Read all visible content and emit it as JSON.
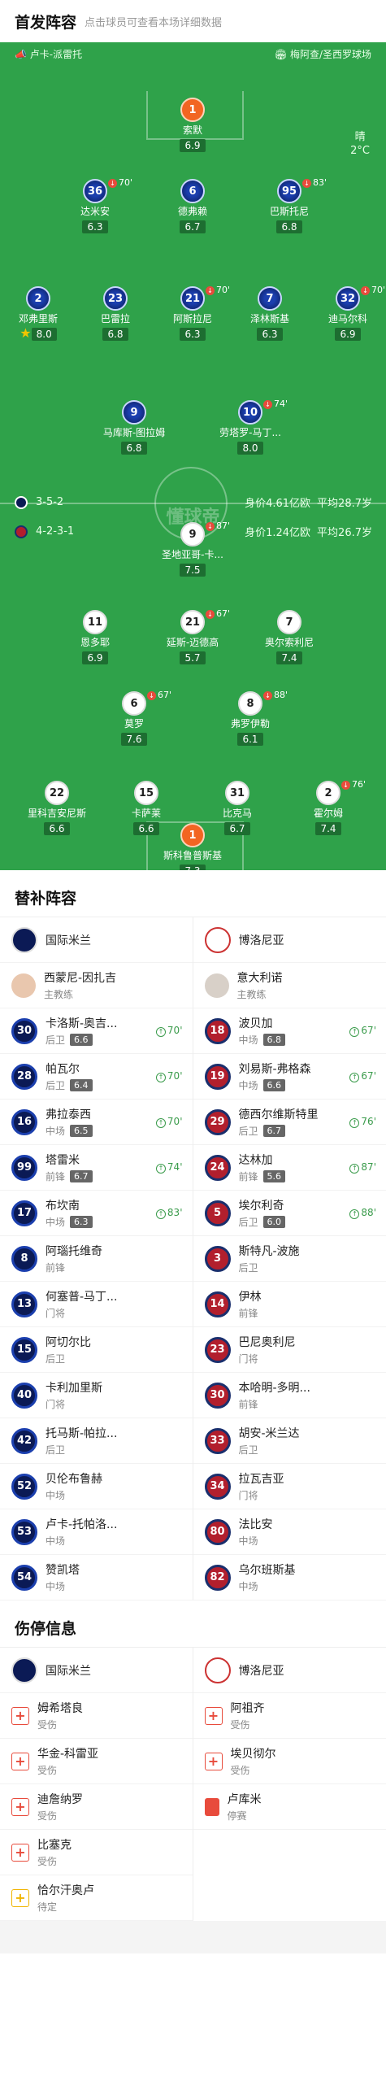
{
  "header": {
    "title": "首发阵容",
    "subtitle": "点击球员可查看本场详细数据"
  },
  "venue": {
    "referee": "卢卡-派雷托",
    "stadium": "梅阿查/圣西罗球场"
  },
  "weather": {
    "condition": "晴",
    "temp": "2°C"
  },
  "watermark": "懂球帝",
  "inter_info": {
    "formation": "3-5-2",
    "value": "身价4.61亿欧",
    "age": "平均28.7岁"
  },
  "bologna_info": {
    "formation": "4-2-3-1",
    "value": "身价1.24亿欧",
    "age": "平均26.7岁"
  },
  "inter_lineup": [
    {
      "num": "1",
      "name": "索默",
      "rating": "6.9",
      "gk": true
    },
    {
      "num": "36",
      "name": "达米安",
      "rating": "6.3",
      "sub": "70'"
    },
    {
      "num": "6",
      "name": "德弗赖",
      "rating": "6.7"
    },
    {
      "num": "95",
      "name": "巴斯托尼",
      "rating": "6.8",
      "sub": "83'"
    },
    {
      "num": "2",
      "name": "邓弗里斯",
      "rating": "8.0",
      "star": true
    },
    {
      "num": "23",
      "name": "巴雷拉",
      "rating": "6.8"
    },
    {
      "num": "21",
      "name": "阿斯拉尼",
      "rating": "6.3",
      "sub": "70'"
    },
    {
      "num": "7",
      "name": "泽林斯基",
      "rating": "6.3"
    },
    {
      "num": "32",
      "name": "迪马尔科",
      "rating": "6.9",
      "sub": "70'"
    },
    {
      "num": "9",
      "name": "马库斯-图拉姆",
      "rating": "6.8"
    },
    {
      "num": "10",
      "name": "劳塔罗-马丁...",
      "rating": "8.0",
      "sub": "74'"
    }
  ],
  "bologna_lineup": [
    {
      "num": "9",
      "name": "圣地亚哥-卡...",
      "rating": "7.5",
      "sub": "87'"
    },
    {
      "num": "11",
      "name": "恩多耶",
      "rating": "6.9"
    },
    {
      "num": "21",
      "name": "延斯-迈德高",
      "rating": "5.7",
      "sub": "67'"
    },
    {
      "num": "7",
      "name": "奥尔索利尼",
      "rating": "7.4"
    },
    {
      "num": "6",
      "name": "莫罗",
      "rating": "7.6",
      "sub": "67'"
    },
    {
      "num": "8",
      "name": "弗罗伊勒",
      "rating": "6.1",
      "sub": "88'"
    },
    {
      "num": "22",
      "name": "里科吉安尼斯",
      "rating": "6.6"
    },
    {
      "num": "15",
      "name": "卡萨莱",
      "rating": "6.6"
    },
    {
      "num": "31",
      "name": "比克马",
      "rating": "6.7"
    },
    {
      "num": "2",
      "name": "霍尔姆",
      "rating": "7.4",
      "sub": "76'"
    },
    {
      "num": "1",
      "name": "斯科鲁普斯基",
      "rating": "7.3",
      "gk": true
    }
  ],
  "subs_title": "替补阵容",
  "teams": {
    "home": "国际米兰",
    "away": "博洛尼亚"
  },
  "coaches": {
    "home_name": "西蒙尼-因扎吉",
    "away_name": "意大利诺",
    "role": "主教练"
  },
  "subs_home": [
    {
      "num": "30",
      "name": "卡洛斯-奥吉...",
      "pos": "后卫",
      "rating": "6.6",
      "time": "70'"
    },
    {
      "num": "28",
      "name": "帕瓦尔",
      "pos": "后卫",
      "rating": "6.4",
      "time": "70'"
    },
    {
      "num": "16",
      "name": "弗拉泰西",
      "pos": "中场",
      "rating": "6.5",
      "time": "70'"
    },
    {
      "num": "99",
      "name": "塔雷米",
      "pos": "前锋",
      "rating": "6.7",
      "time": "74'"
    },
    {
      "num": "17",
      "name": "布坎南",
      "pos": "中场",
      "rating": "6.3",
      "time": "83'"
    },
    {
      "num": "8",
      "name": "阿瑙托维奇",
      "pos": "前锋"
    },
    {
      "num": "13",
      "name": "何塞普-马丁...",
      "pos": "门将"
    },
    {
      "num": "15",
      "name": "阿切尔比",
      "pos": "后卫"
    },
    {
      "num": "40",
      "name": "卡利加里斯",
      "pos": "门将"
    },
    {
      "num": "42",
      "name": "托马斯-帕拉...",
      "pos": "后卫"
    },
    {
      "num": "52",
      "name": "贝伦布鲁赫",
      "pos": "中场"
    },
    {
      "num": "53",
      "name": "卢卡-托帕洛...",
      "pos": "中场"
    },
    {
      "num": "54",
      "name": "赞凯塔",
      "pos": "中场"
    }
  ],
  "subs_away": [
    {
      "num": "18",
      "name": "波贝加",
      "pos": "中场",
      "rating": "6.8",
      "time": "67'"
    },
    {
      "num": "19",
      "name": "刘易斯-弗格森",
      "pos": "中场",
      "rating": "6.6",
      "time": "67'"
    },
    {
      "num": "29",
      "name": "德西尔维斯特里",
      "pos": "后卫",
      "rating": "6.7",
      "time": "76'"
    },
    {
      "num": "24",
      "name": "达林加",
      "pos": "前锋",
      "rating": "5.6",
      "time": "87'"
    },
    {
      "num": "5",
      "name": "埃尔利奇",
      "pos": "后卫",
      "rating": "6.0",
      "time": "88'"
    },
    {
      "num": "3",
      "name": "斯特凡-波施",
      "pos": "后卫"
    },
    {
      "num": "14",
      "name": "伊林",
      "pos": "前锋"
    },
    {
      "num": "23",
      "name": "巴尼奥利尼",
      "pos": "门将"
    },
    {
      "num": "30",
      "name": "本哈明-多明...",
      "pos": "前锋"
    },
    {
      "num": "33",
      "name": "胡安-米兰达",
      "pos": "后卫"
    },
    {
      "num": "34",
      "name": "拉瓦吉亚",
      "pos": "门将"
    },
    {
      "num": "80",
      "name": "法比安",
      "pos": "中场"
    },
    {
      "num": "82",
      "name": "乌尔班斯基",
      "pos": "中场"
    }
  ],
  "injury_title": "伤停信息",
  "injuries_home": [
    {
      "name": "姆希塔良",
      "status": "受伤",
      "icon": "red-cross-icon"
    },
    {
      "name": "华金-科雷亚",
      "status": "受伤",
      "icon": "red-cross-icon"
    },
    {
      "name": "迪詹纳罗",
      "status": "受伤",
      "icon": "red-cross-icon"
    },
    {
      "name": "比塞克",
      "status": "受伤",
      "icon": "red-cross-icon"
    },
    {
      "name": "恰尔汗奥卢",
      "status": "待定",
      "icon": "yellow-cross-icon"
    }
  ],
  "injuries_away": [
    {
      "name": "阿祖齐",
      "status": "受伤",
      "icon": "red-cross-icon"
    },
    {
      "name": "埃贝彻尔",
      "status": "受伤",
      "icon": "red-cross-icon"
    },
    {
      "name": "卢库米",
      "status": "停赛",
      "icon": "red-card-icon"
    }
  ]
}
